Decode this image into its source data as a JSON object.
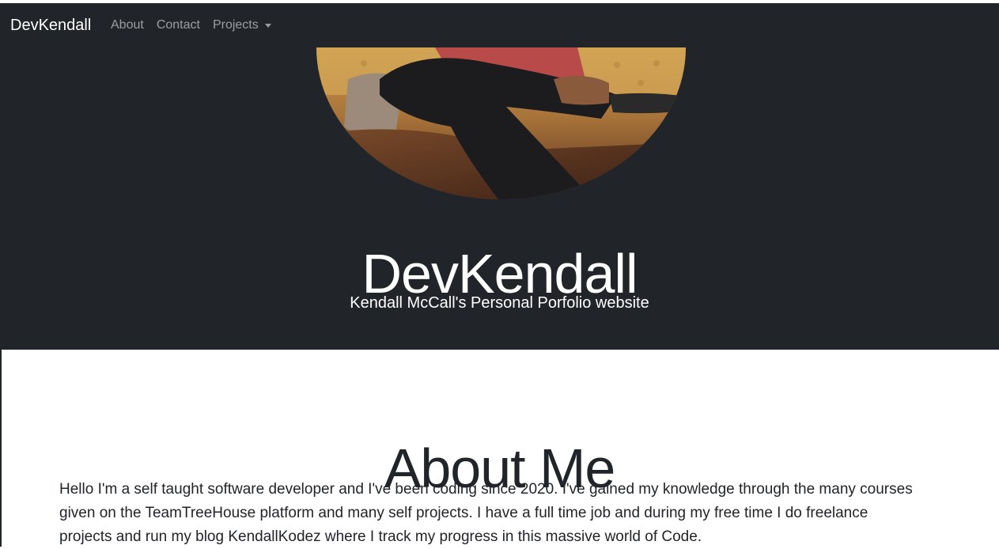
{
  "navbar": {
    "brand": "DevKendall",
    "links": [
      {
        "label": "About"
      },
      {
        "label": "Contact"
      },
      {
        "label": "Projects"
      }
    ]
  },
  "hero": {
    "title": "DevKendall",
    "subtitle": "Kendall McCall's Personal Porfolio website",
    "photo_icon": "profile-photo"
  },
  "about": {
    "heading": "About Me",
    "body": "Hello I'm a self taught software developer and I've been coding since 2020. I've gained my knowledge through the many courses given on the TeamTreeHouse platform and many self projects. I have a full time job and during my free time I do freelance projects and run my blog KendallKodez where I track my progress in this massive world of Code."
  },
  "colors": {
    "dark": "#212529",
    "nav_link": "rgba(255,255,255,0.55)",
    "white": "#ffffff"
  }
}
